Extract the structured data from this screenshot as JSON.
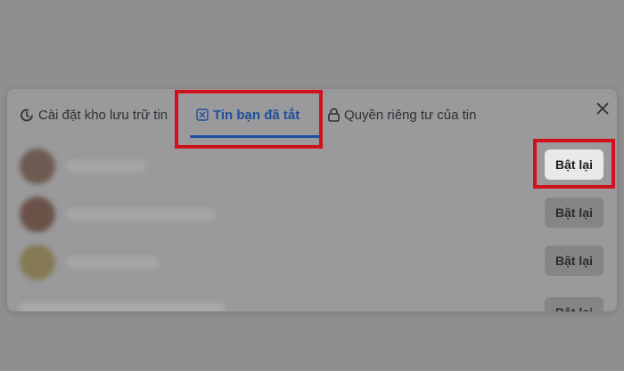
{
  "tabs": {
    "archive_settings": "Cài đặt kho lưu trữ tin",
    "muted_stories": "Tin bạn đã tắt",
    "story_privacy": "Quyền riêng tư của tin"
  },
  "muted_list": {
    "button_label": "Bật lại",
    "rows": [
      {
        "avatar_color": "#6e5a50",
        "button_label": "Bật lại"
      },
      {
        "avatar_color": "#6b5248",
        "button_label": "Bật lại"
      },
      {
        "avatar_color": "#857a55",
        "button_label": "Bật lại"
      },
      {
        "avatar_color": "#8c8c90",
        "button_label": "Bật lại"
      }
    ]
  },
  "icons": {
    "archive_tab": "clock-history-icon",
    "muted_tab": "x-box-icon",
    "privacy_tab": "lock-icon",
    "close": "close-icon"
  },
  "colors": {
    "active_tab": "#1d4f9a",
    "highlight": "#d0111c",
    "overlay": "#8f8f91"
  }
}
